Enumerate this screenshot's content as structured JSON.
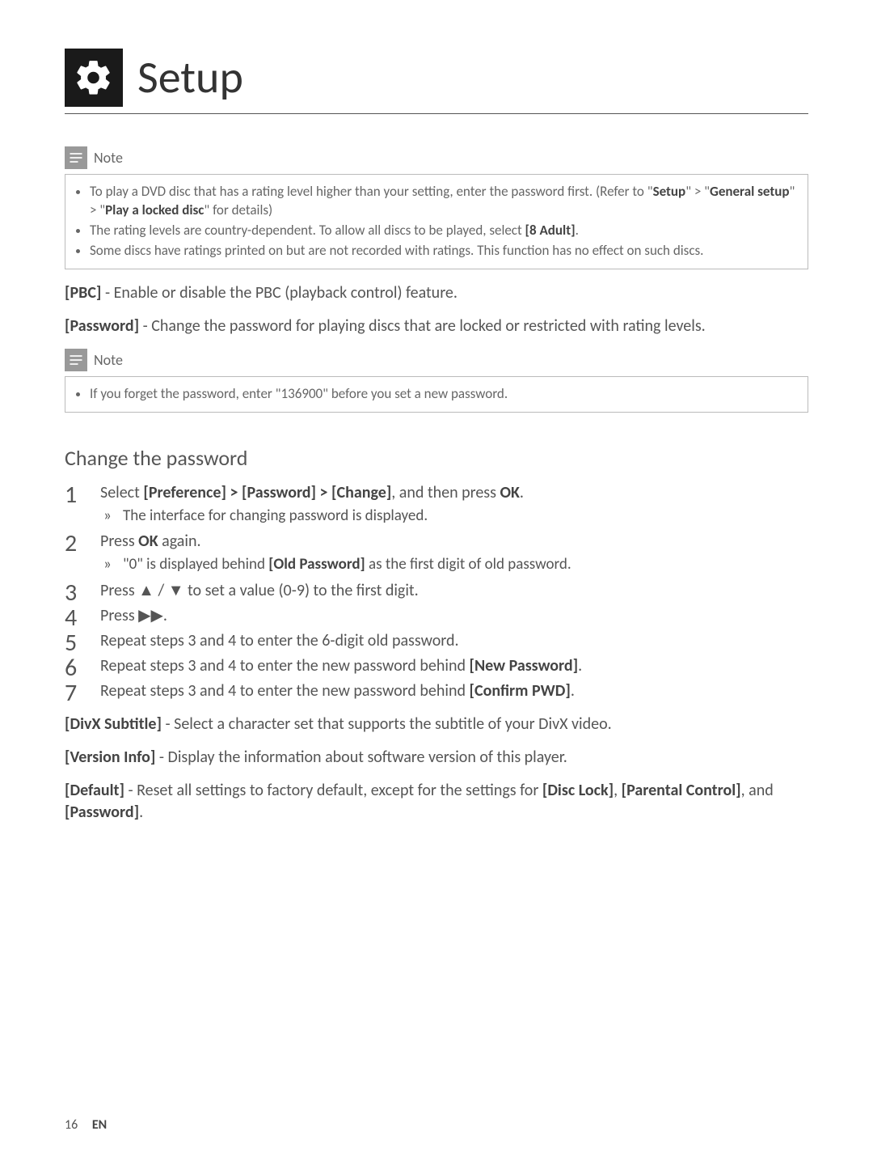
{
  "header": {
    "title": "Setup"
  },
  "note1": {
    "label": "Note",
    "items": [
      "To play a DVD disc that has a rating level higher than your setting, enter the password first. (Refer to \"<b>Setup</b>\" > \"<b>General setup</b>\" > \"<b>Play a locked disc</b>\" for details)",
      "The rating levels are country-dependent. To allow all discs to be played, select <b>[8 Adult]</b>.",
      "Some discs have ratings printed on but are not recorded with ratings. This function has no effect on such discs."
    ]
  },
  "pbc": "<b>[PBC]</b> - Enable or disable the PBC (playback control) feature.",
  "password": "<b>[Password]</b> - Change the password for playing discs that are locked or restricted with rating levels.",
  "note2": {
    "label": "Note",
    "items": [
      "If you forget the password, enter \"136900\" before you set a new password."
    ]
  },
  "section": {
    "heading": "Change the password"
  },
  "steps": [
    {
      "text": "Select <b>[Preference] > [Password] > [Change]</b>, and then press <b>OK</b>.",
      "sub": "The interface for changing password is displayed."
    },
    {
      "text": "Press <b>OK</b> again.",
      "sub": "\"0\" is displayed behind <b>[Old Password]</b> as the first digit of old password."
    },
    {
      "text": "Press ▲ / ▼ to set a value (0-9) to the first digit."
    },
    {
      "text": "Press ▶▶."
    },
    {
      "text": "Repeat steps 3 and 4 to enter the 6-digit old password."
    },
    {
      "text": "Repeat steps 3 and 4 to enter the new password behind <b>[New Password]</b>."
    },
    {
      "text": "Repeat steps 3 and 4 to enter the new password behind <b>[Confirm PWD]</b>."
    }
  ],
  "divx": "<b>[DivX Subtitle]</b> - Select a character set that supports the subtitle of your DivX video.",
  "version": "<b>[Version Info]</b> - Display the information about software version of this player.",
  "default": "<b>[Default]</b> - Reset all settings to factory default, except for the settings for <b>[Disc Lock]</b>, <b>[Parental Control]</b>, and <b>[Password]</b>.",
  "footer": {
    "page": "16",
    "lang": "EN"
  }
}
